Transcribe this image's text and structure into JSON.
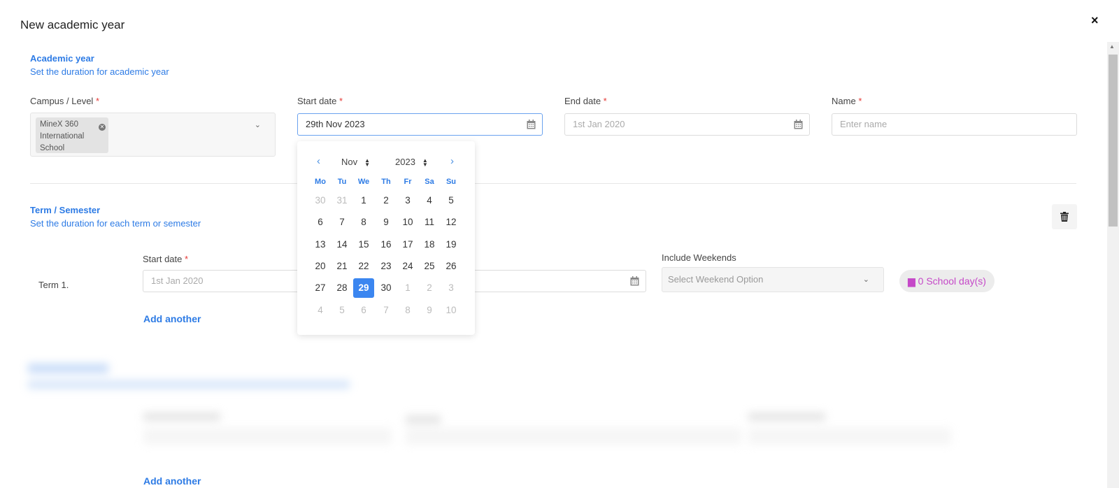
{
  "dialog": {
    "title": "New academic year",
    "close": "×"
  },
  "academic_year": {
    "title": "Academic year",
    "subtitle": "Set the duration for academic year",
    "campus_label": "Campus / Level",
    "campus_chip_lines": [
      "MineX 360",
      "International",
      "School"
    ],
    "start_label": "Start date",
    "start_value": "29th Nov 2023",
    "end_label": "End date",
    "end_placeholder": "1st Jan 2020",
    "name_label": "Name",
    "name_placeholder": "Enter name",
    "required_mark": "*"
  },
  "calendar": {
    "month": "Nov",
    "year": "2023",
    "weekdays": [
      "Mo",
      "Tu",
      "We",
      "Th",
      "Fr",
      "Sa",
      "Su"
    ],
    "weeks": [
      [
        [
          "30",
          1
        ],
        [
          "31",
          1
        ],
        [
          "1",
          0
        ],
        [
          "2",
          0
        ],
        [
          "3",
          0
        ],
        [
          "4",
          0
        ],
        [
          "5",
          0
        ]
      ],
      [
        [
          "6",
          0
        ],
        [
          "7",
          0
        ],
        [
          "8",
          0
        ],
        [
          "9",
          0
        ],
        [
          "10",
          0
        ],
        [
          "11",
          0
        ],
        [
          "12",
          0
        ]
      ],
      [
        [
          "13",
          0
        ],
        [
          "14",
          0
        ],
        [
          "15",
          0
        ],
        [
          "16",
          0
        ],
        [
          "17",
          0
        ],
        [
          "18",
          0
        ],
        [
          "19",
          0
        ]
      ],
      [
        [
          "20",
          0
        ],
        [
          "21",
          0
        ],
        [
          "22",
          0
        ],
        [
          "23",
          0
        ],
        [
          "24",
          0
        ],
        [
          "25",
          0
        ],
        [
          "26",
          0
        ]
      ],
      [
        [
          "27",
          0
        ],
        [
          "28",
          0
        ],
        [
          "29",
          2
        ],
        [
          "30",
          0
        ],
        [
          "1",
          1
        ],
        [
          "2",
          1
        ],
        [
          "3",
          1
        ]
      ],
      [
        [
          "4",
          1
        ],
        [
          "5",
          1
        ],
        [
          "6",
          1
        ],
        [
          "7",
          1
        ],
        [
          "8",
          1
        ],
        [
          "9",
          1
        ],
        [
          "10",
          1
        ]
      ]
    ]
  },
  "term": {
    "title": "Term / Semester",
    "subtitle": "Set the duration for each term or semester",
    "row_label": "Term 1.",
    "start_label": "Start date",
    "start_placeholder": "1st Jan 2020",
    "weekends_label": "Include Weekends",
    "weekends_placeholder": "Select Weekend Option",
    "school_days": "0 School day(s)",
    "add_another": "Add another"
  },
  "lower": {
    "add_another": "Add another"
  },
  "colors": {
    "accent": "#2d7be5",
    "selected": "#3b86f0",
    "badge_text": "#c548c8",
    "required": "#e53935"
  }
}
